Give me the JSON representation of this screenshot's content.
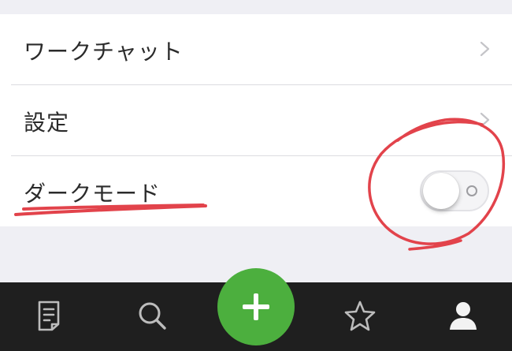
{
  "menu": {
    "items": [
      {
        "label": "ワークチャット",
        "has_chevron": true
      },
      {
        "label": "設定",
        "has_chevron": true
      },
      {
        "label": "ダークモード",
        "control": "toggle"
      }
    ]
  },
  "dark_mode_toggle": {
    "state": "off"
  },
  "annotations": {
    "color": "#e2434b",
    "shapes": [
      "underline",
      "circle"
    ]
  },
  "tab_bar": {
    "background": "#1f1f1f",
    "items": [
      {
        "icon": "notes-icon"
      },
      {
        "icon": "search-icon"
      },
      {
        "icon": "plus-icon",
        "accent": "#4caf3e"
      },
      {
        "icon": "star-icon"
      },
      {
        "icon": "profile-icon"
      }
    ]
  }
}
